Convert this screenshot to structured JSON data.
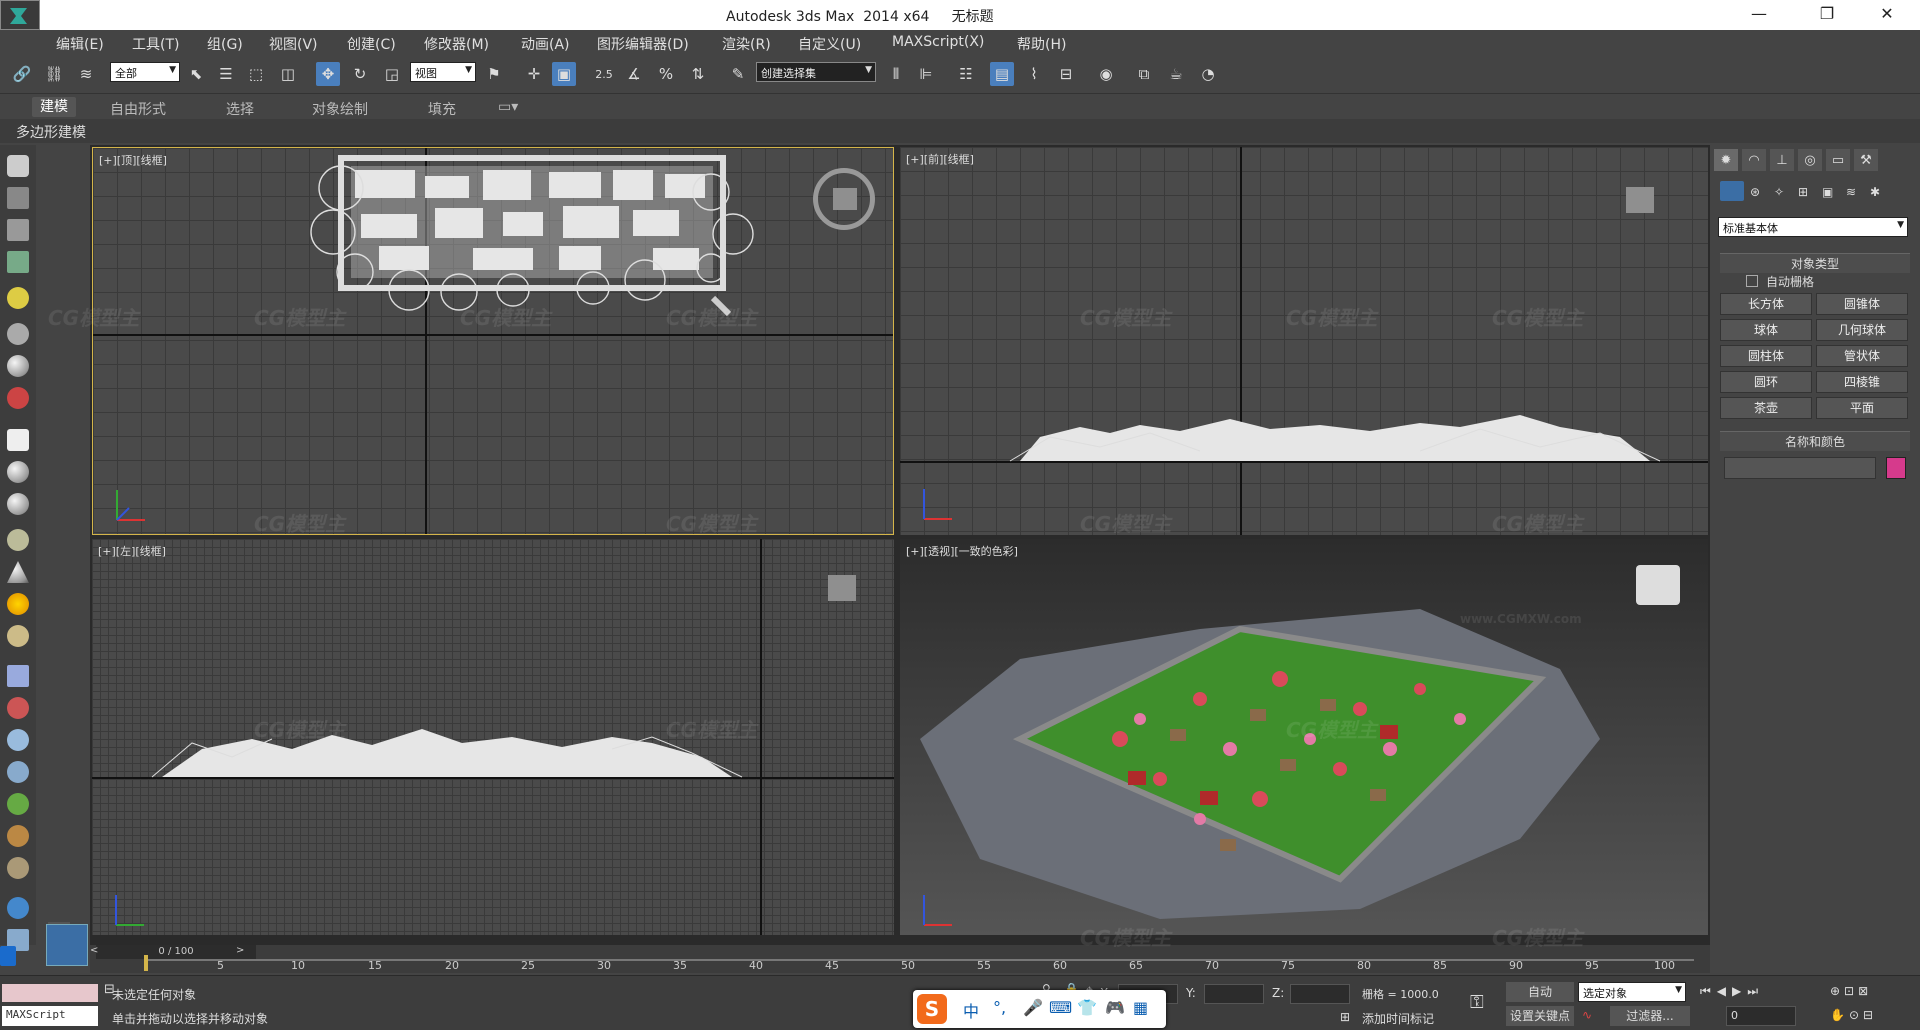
{
  "titlebar": {
    "title": "Autodesk 3ds Max  2014 x64     无标题",
    "minimize": "—",
    "restore": "❐",
    "close": "✕"
  },
  "menu": [
    "编辑(E)",
    "工具(T)",
    "组(G)",
    "视图(V)",
    "创建(C)",
    "修改器(M)",
    "动画(A)",
    "图形编辑器(D)",
    "渲染(R)",
    "自定义(U)",
    "MAXScript(X)",
    "帮助(H)"
  ],
  "toolbar": {
    "selection_filter": "全部",
    "reference_coord": "视图",
    "named_selection": "创建选择集",
    "snap_label": "2.5"
  },
  "ribbon": {
    "tabs": [
      "建模",
      "自由形式",
      "选择",
      "对象绘制",
      "填充"
    ],
    "active_tab": "建模",
    "sub_label": "多边形建模"
  },
  "viewports": {
    "top": "[+][顶][线框]",
    "front": "[+][前][线框]",
    "left": "[+][左][线框]",
    "perspective": "[+][透视][一致的色彩]"
  },
  "command_panel": {
    "dropdown": "标准基本体",
    "object_type_header": "对象类型",
    "auto_grid": "自动栅格",
    "buttons": [
      "长方体",
      "圆锥体",
      "球体",
      "几何球体",
      "圆柱体",
      "管状体",
      "圆环",
      "四棱锥",
      "茶壶",
      "平面"
    ],
    "name_color_header": "名称和颜色",
    "object_color": "#d63a8c"
  },
  "timeline": {
    "frame_display": "0 / 100",
    "ticks": [
      "5",
      "10",
      "15",
      "20",
      "25",
      "30",
      "35",
      "40",
      "45",
      "50",
      "55",
      "60",
      "65",
      "70",
      "75",
      "80",
      "85",
      "90",
      "95",
      "100"
    ]
  },
  "status": {
    "maxscript": "MAXScript",
    "selection_status": "未选定任何对象",
    "prompt": "单击并拖动以选择并移动对象",
    "x_label": "X:",
    "y_label": "Y:",
    "z_label": "Z:",
    "grid": "栅格 = 1000.0",
    "auto_key": "自动",
    "selected_object": "选定对象",
    "set_key": "设置关键点",
    "filters": "过滤器...",
    "add_time_tag": "添加时间标记",
    "current_frame": "0"
  },
  "ime": {
    "lang": "中",
    "punct": "°,"
  },
  "watermark": {
    "logo": "CG模型主",
    "url": "www.CGMXW.com"
  }
}
